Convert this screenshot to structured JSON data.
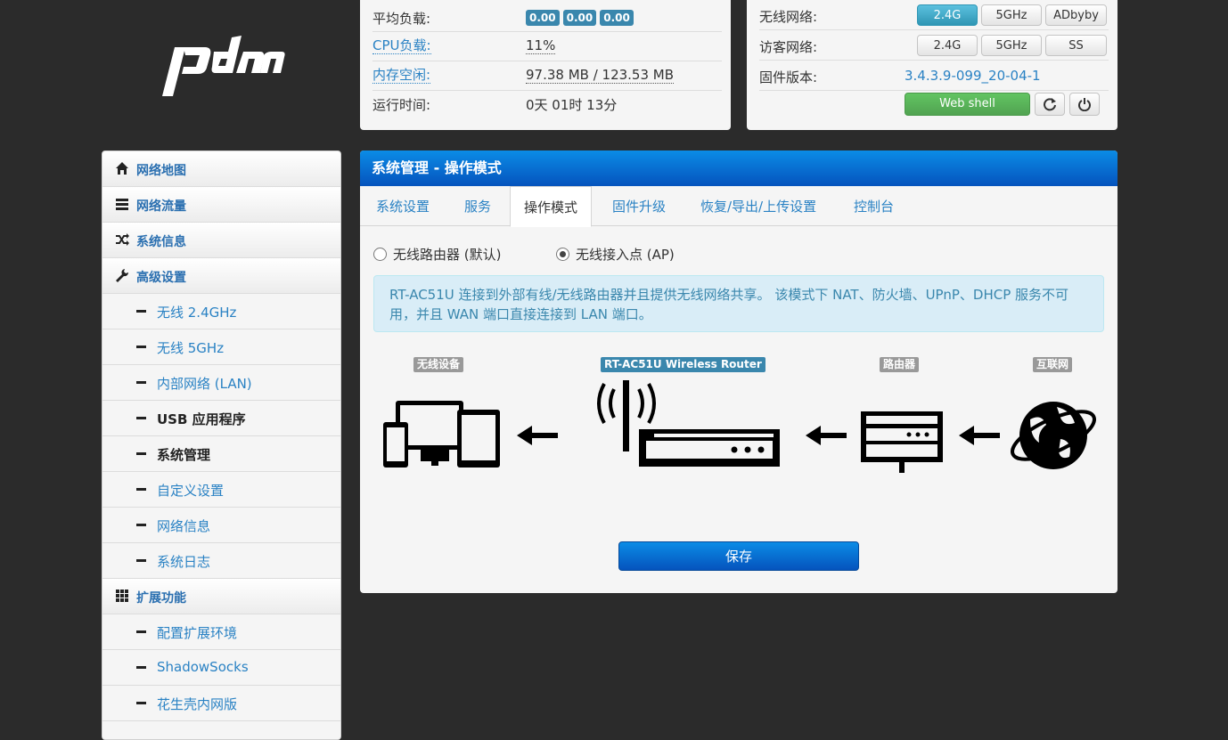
{
  "status": {
    "load_label": "平均负载:",
    "load_values": [
      "0.00",
      "0.00",
      "0.00"
    ],
    "cpu_label": "CPU负载:",
    "cpu_value": "11%",
    "mem_label": "内存空闲:",
    "mem_value": "97.38 MB / 123.53 MB",
    "uptime_label": "运行时间:",
    "uptime_value": "0天 01时 13分"
  },
  "quick": {
    "wireless_label": "无线网络:",
    "wireless_buttons": [
      "2.4G",
      "5GHz",
      "ADbyby"
    ],
    "guest_label": "访客网络:",
    "guest_buttons": [
      "2.4G",
      "5GHz",
      "SS"
    ],
    "firmware_label": "固件版本:",
    "firmware_value": "3.4.3.9-099_20-04-1",
    "webshell_label": "Web shell",
    "refresh_icon": "refresh-icon",
    "power_icon": "power-icon"
  },
  "sidebar": {
    "items": [
      {
        "label": "网络地图",
        "icon": "home-icon"
      },
      {
        "label": "网络流量",
        "icon": "server-icon"
      },
      {
        "label": "系统信息",
        "icon": "shuffle-icon"
      },
      {
        "label": "高级设置",
        "icon": "wrench-icon"
      },
      {
        "label": "无线 2.4GHz"
      },
      {
        "label": "无线 5GHz"
      },
      {
        "label": "内部网络 (LAN)"
      },
      {
        "label": "USB 应用程序"
      },
      {
        "label": "系统管理"
      },
      {
        "label": "自定义设置"
      },
      {
        "label": "网络信息"
      },
      {
        "label": "系统日志"
      },
      {
        "label": "扩展功能",
        "icon": "grid-icon"
      },
      {
        "label": "配置扩展环境"
      },
      {
        "label": "ShadowSocks"
      },
      {
        "label": "花生壳内网版"
      }
    ]
  },
  "main": {
    "title": "系统管理 - 操作模式",
    "tabs": [
      "系统设置",
      "服务",
      "操作模式",
      "固件升级",
      "恢复/导出/上传设置",
      "控制台"
    ],
    "active_tab": "操作模式",
    "mode_router": "无线路由器 (默认)",
    "mode_ap": "无线接入点 (AP)",
    "selected_mode": "无线接入点 (AP)",
    "info_text": "RT-AC51U 连接到外部有线/无线路由器并且提供无线网络共享。 该模式下 NAT、防火墙、UPnP、DHCP 服务不可用，并且 WAN 端口直接连接到 LAN 端口。",
    "diagram": {
      "devices_label": "无线设备",
      "this_router_label": "RT-AC51U Wireless Router",
      "router_label": "路由器",
      "internet_label": "互联网"
    },
    "save_label": "保存"
  },
  "colors": {
    "accent": "#0b6fd6",
    "link": "#2a82c4",
    "badge": "#3a87ad",
    "green": "#51a351",
    "background": "#2b2b2b"
  }
}
